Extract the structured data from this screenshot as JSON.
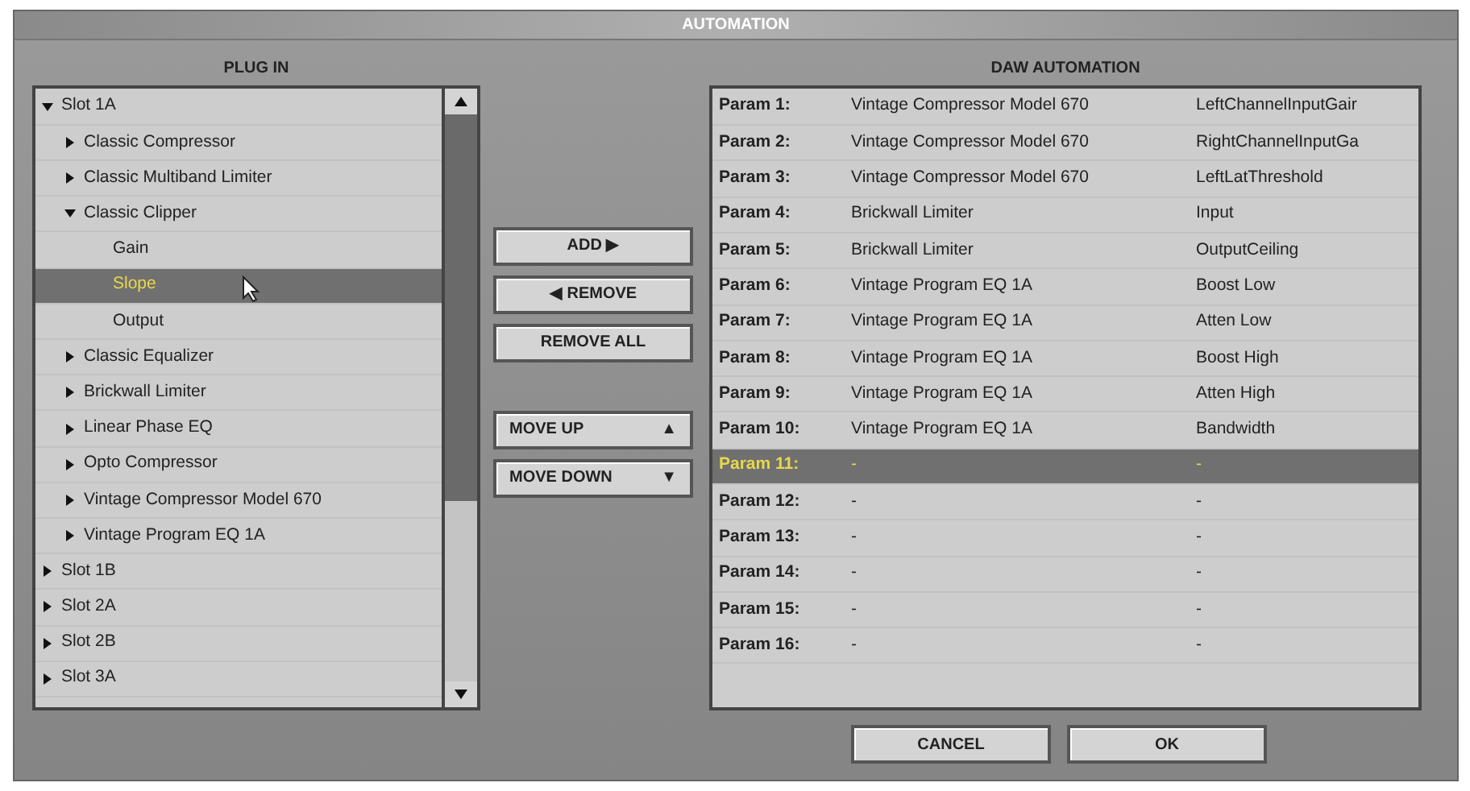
{
  "window": {
    "title": "AUTOMATION"
  },
  "plugin_panel": {
    "heading": "PLUG IN",
    "tree": [
      {
        "label": "Slot 1A",
        "kind": "folder",
        "expanded": true,
        "selected": false,
        "children": [
          {
            "label": "Classic Compressor",
            "kind": "folder",
            "expanded": false,
            "selected": false
          },
          {
            "label": "Classic Multiband Limiter",
            "kind": "folder",
            "expanded": false,
            "selected": false
          },
          {
            "label": "Classic Clipper",
            "kind": "folder",
            "expanded": true,
            "selected": false,
            "children": [
              {
                "label": "Gain",
                "kind": "leaf",
                "selected": false
              },
              {
                "label": "Slope",
                "kind": "leaf",
                "selected": true
              },
              {
                "label": "Output",
                "kind": "leaf",
                "selected": false
              }
            ]
          },
          {
            "label": "Classic Equalizer",
            "kind": "folder",
            "expanded": false,
            "selected": false
          },
          {
            "label": "Brickwall Limiter",
            "kind": "folder",
            "expanded": false,
            "selected": false
          },
          {
            "label": "Linear Phase EQ",
            "kind": "folder",
            "expanded": false,
            "selected": false
          },
          {
            "label": "Opto Compressor",
            "kind": "folder",
            "expanded": false,
            "selected": false
          },
          {
            "label": "Vintage Compressor Model 670",
            "kind": "folder",
            "expanded": false,
            "selected": false
          },
          {
            "label": "Vintage Program EQ 1A",
            "kind": "folder",
            "expanded": false,
            "selected": false
          }
        ]
      },
      {
        "label": "Slot 1B",
        "kind": "folder",
        "expanded": false,
        "selected": false
      },
      {
        "label": "Slot 2A",
        "kind": "folder",
        "expanded": false,
        "selected": false
      },
      {
        "label": "Slot 2B",
        "kind": "folder",
        "expanded": false,
        "selected": false
      },
      {
        "label": "Slot 3A",
        "kind": "folder",
        "expanded": false,
        "selected": false
      }
    ]
  },
  "middle_buttons": [
    {
      "label": "ADD ▶",
      "kind": "plain"
    },
    {
      "label": "◀ REMOVE",
      "kind": "plain"
    },
    {
      "label": "REMOVE ALL",
      "kind": "plain"
    }
  ],
  "move_buttons": [
    {
      "label": "MOVE UP",
      "arrow": "▲"
    },
    {
      "label": "MOVE DOWN",
      "arrow": "▼"
    }
  ],
  "automation_panel": {
    "heading": "DAW AUTOMATION",
    "rows": [
      {
        "param": "Param 1:",
        "plugin": "Vintage Compressor Model 670",
        "parameter": "LeftChannelInputGair",
        "selected": false
      },
      {
        "param": "Param 2:",
        "plugin": "Vintage Compressor Model 670",
        "parameter": "RightChannelInputGa",
        "selected": false
      },
      {
        "param": "Param 3:",
        "plugin": "Vintage Compressor Model 670",
        "parameter": "LeftLatThreshold",
        "selected": false
      },
      {
        "param": "Param 4:",
        "plugin": "Brickwall Limiter",
        "parameter": "Input",
        "selected": false
      },
      {
        "param": "Param 5:",
        "plugin": "Brickwall Limiter",
        "parameter": "OutputCeiling",
        "selected": false
      },
      {
        "param": "Param 6:",
        "plugin": "Vintage Program EQ 1A",
        "parameter": "Boost Low",
        "selected": false
      },
      {
        "param": "Param 7:",
        "plugin": "Vintage Program EQ 1A",
        "parameter": "Atten Low",
        "selected": false
      },
      {
        "param": "Param 8:",
        "plugin": "Vintage Program EQ 1A",
        "parameter": "Boost High",
        "selected": false
      },
      {
        "param": "Param 9:",
        "plugin": "Vintage Program EQ 1A",
        "parameter": "Atten High",
        "selected": false
      },
      {
        "param": "Param 10:",
        "plugin": "Vintage Program EQ 1A",
        "parameter": "Bandwidth",
        "selected": false
      },
      {
        "param": "Param 11:",
        "plugin": "-",
        "parameter": "-",
        "selected": true
      },
      {
        "param": "Param 12:",
        "plugin": "-",
        "parameter": "-",
        "selected": false
      },
      {
        "param": "Param 13:",
        "plugin": "-",
        "parameter": "-",
        "selected": false
      },
      {
        "param": "Param 14:",
        "plugin": "-",
        "parameter": "-",
        "selected": false
      },
      {
        "param": "Param 15:",
        "plugin": "-",
        "parameter": "-",
        "selected": false
      },
      {
        "param": "Param 16:",
        "plugin": "-",
        "parameter": "-",
        "selected": false
      }
    ]
  },
  "footer_buttons": [
    "CANCEL",
    "OK"
  ]
}
